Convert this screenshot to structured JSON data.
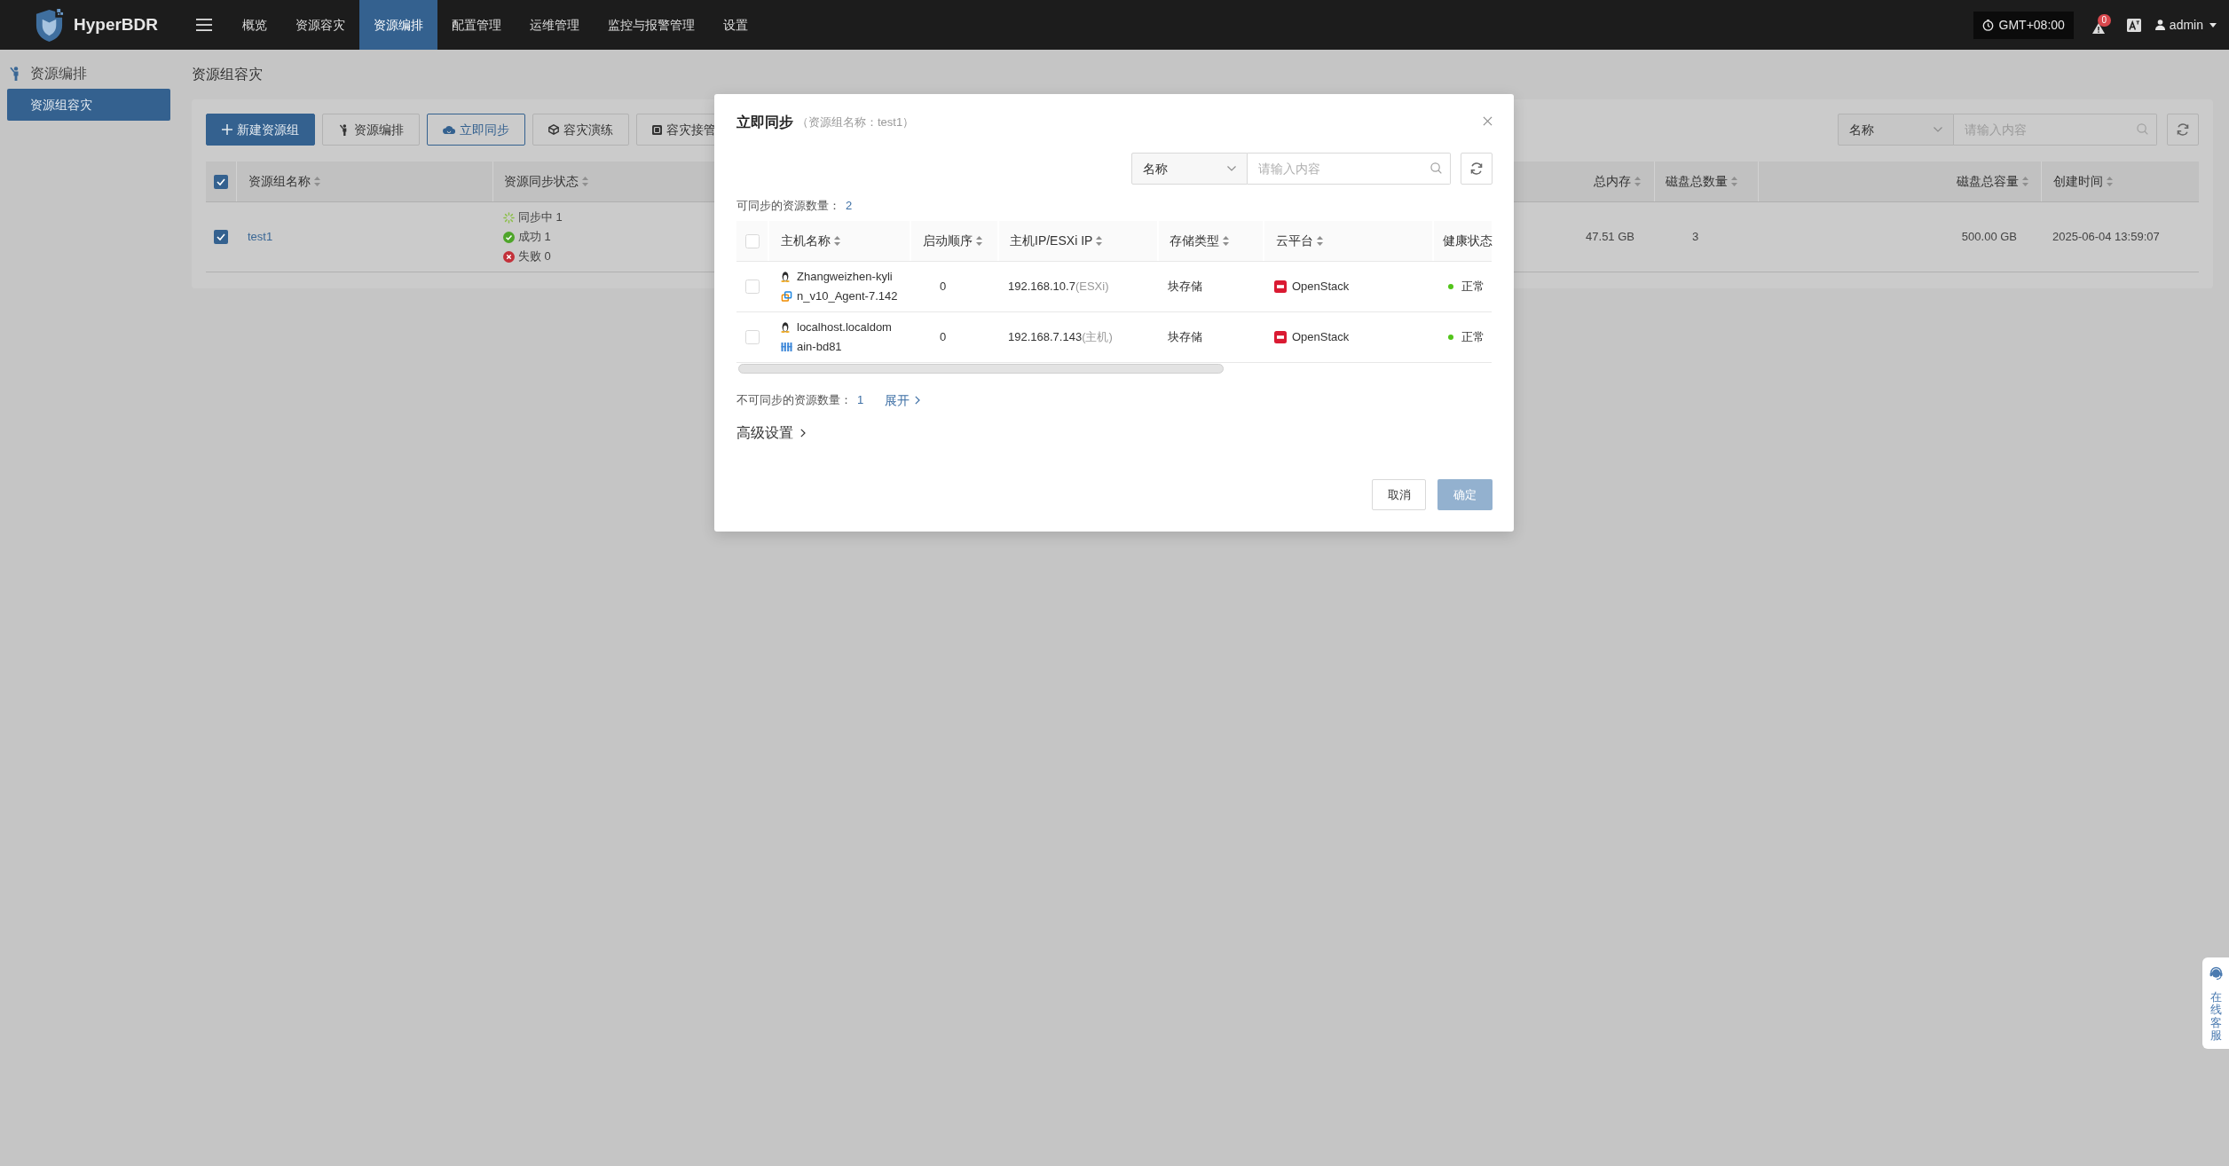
{
  "nav": {
    "brand": "HyperBDR",
    "items": [
      {
        "label": "概览",
        "selected": false
      },
      {
        "label": "资源容灾",
        "selected": false
      },
      {
        "label": "资源编排",
        "selected": true
      },
      {
        "label": "配置管理",
        "selected": false
      },
      {
        "label": "运维管理",
        "selected": false
      },
      {
        "label": "监控与报警管理",
        "selected": false
      },
      {
        "label": "设置",
        "selected": false
      }
    ],
    "timezone": "GMT+08:00",
    "alert_count": "0",
    "user": "admin"
  },
  "sidebar": {
    "title": "资源编排",
    "items": [
      {
        "label": "资源组容灾",
        "selected": true
      }
    ]
  },
  "page": {
    "title": "资源组容灾",
    "toolbar": [
      {
        "label": "新建资源组",
        "kind": "primary"
      },
      {
        "label": "资源编排",
        "kind": "default"
      },
      {
        "label": "立即同步",
        "kind": "active"
      },
      {
        "label": "容灾演练",
        "kind": "default"
      },
      {
        "label": "容灾接管",
        "kind": "default"
      }
    ],
    "search": {
      "field": "名称",
      "placeholder": "请输入内容"
    },
    "table": {
      "header_checked": true,
      "columns": [
        {
          "label": "资源组名称",
          "sortable": true
        },
        {
          "label": "资源同步状态",
          "sortable": true
        },
        {
          "label": "总内存",
          "sortable": true
        },
        {
          "label": "磁盘总数量",
          "sortable": true
        },
        {
          "label": "磁盘总容量",
          "sortable": true
        },
        {
          "label": "创建时间",
          "sortable": true
        }
      ],
      "rows": [
        {
          "checked": true,
          "name": "test1",
          "sync_status": [
            {
              "kind": "syncing",
              "text": "同步中 1"
            },
            {
              "kind": "success",
              "text": "成功 1"
            },
            {
              "kind": "failed",
              "text": "失败 0"
            }
          ],
          "memory": "47.51 GB",
          "disk_count": "3",
          "disk_capacity": "500.00 GB",
          "created_at": "2025-06-04 13:59:07"
        }
      ]
    }
  },
  "dialog": {
    "title": "立即同步",
    "subtitle": "（资源组名称：test1）",
    "search": {
      "field": "名称",
      "placeholder": "请输入内容"
    },
    "syncable_label": "可同步的资源数量：",
    "syncable_count": "2",
    "table": {
      "header_checked": false,
      "columns": [
        {
          "label": "主机名称",
          "sortable": true
        },
        {
          "label": "启动顺序",
          "sortable": true
        },
        {
          "label": "主机IP/ESXi IP",
          "sortable": true
        },
        {
          "label": "存储类型",
          "sortable": true
        },
        {
          "label": "云平台",
          "sortable": true
        },
        {
          "label": "健康状态",
          "sortable": false
        }
      ],
      "rows": [
        {
          "checked": false,
          "kind": "esxi",
          "host_name": "Zhangweizhen-kylin_v10_Agent-7.142",
          "boot_order": "0",
          "ip": "192.168.10.7",
          "ip_type": "(ESXi)",
          "storage": "块存储",
          "platform": "OpenStack",
          "health": {
            "text": "正常",
            "color": "#52c41a"
          }
        },
        {
          "checked": false,
          "kind": "host",
          "host_name": "localhost.localdomain-bd81",
          "boot_order": "0",
          "ip": "192.168.7.143",
          "ip_type": "(主机)",
          "storage": "块存储",
          "platform": "OpenStack",
          "health": {
            "text": "正常",
            "color": "#52c41a"
          }
        }
      ]
    },
    "unsyncable_label": "不可同步的资源数量：",
    "unsyncable_count": "1",
    "expand_link": "展开",
    "advanced_label": "高级设置",
    "buttons": [
      {
        "label": "取消",
        "kind": "default",
        "disabled": false
      },
      {
        "label": "确定",
        "kind": "primary",
        "disabled": true
      }
    ]
  },
  "support_widget": {
    "label": "在线客服"
  }
}
